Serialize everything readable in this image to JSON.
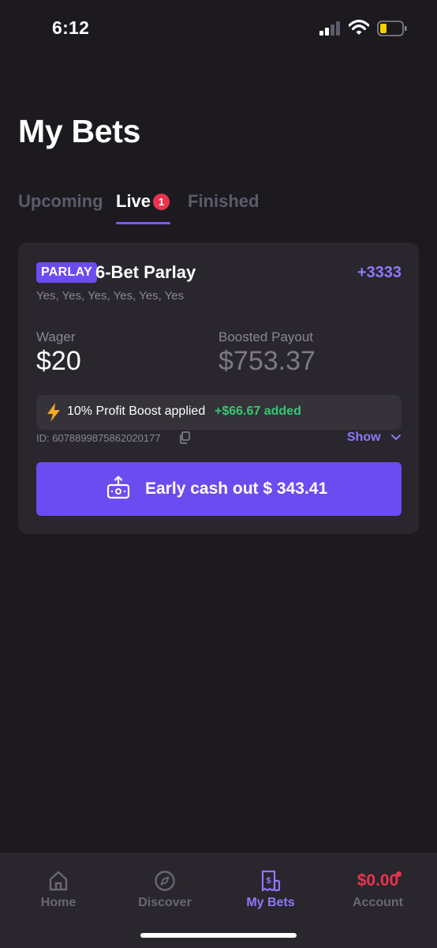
{
  "status_bar": {
    "time": "6:12"
  },
  "page": {
    "title": "My Bets"
  },
  "tabs": [
    {
      "label": "Upcoming"
    },
    {
      "label": "Live",
      "badge": "1"
    },
    {
      "label": "Finished"
    }
  ],
  "bet": {
    "tag": "PARLAY",
    "name": "6-Bet Parlay",
    "odds": "+3333",
    "picks": "Yes, Yes, Yes, Yes, Yes, Yes",
    "wager_label": "Wager",
    "wager_value": "$20",
    "payout_label": "Boosted Payout",
    "payout_value": "$753.37",
    "boost_text": "10% Profit Boost applied",
    "boost_added": "+$66.67 added",
    "id": "ID: 6078899875862020177",
    "show_label": "Show",
    "cashout_label": "Early cash out $ 343.41"
  },
  "nav": {
    "home": "Home",
    "discover": "Discover",
    "bets": "My Bets",
    "account": "Account",
    "balance": "$0.00"
  },
  "colors": {
    "background": "#1c1a1f",
    "card": "#29262d",
    "accent": "#6b4cf0",
    "accent_text": "#8f78fb",
    "positive": "#34c873",
    "alert": "#e8344e"
  },
  "icons": {
    "signal": "cellular-signal-icon",
    "wifi": "wifi-icon",
    "battery": "battery-low-icon",
    "boost": "lightning-bolt-icon",
    "copy": "copy-icon",
    "chevron": "chevron-down-icon",
    "cashout": "cash-out-icon",
    "home": "home-icon",
    "discover": "compass-icon",
    "bets": "bet-slip-icon"
  }
}
